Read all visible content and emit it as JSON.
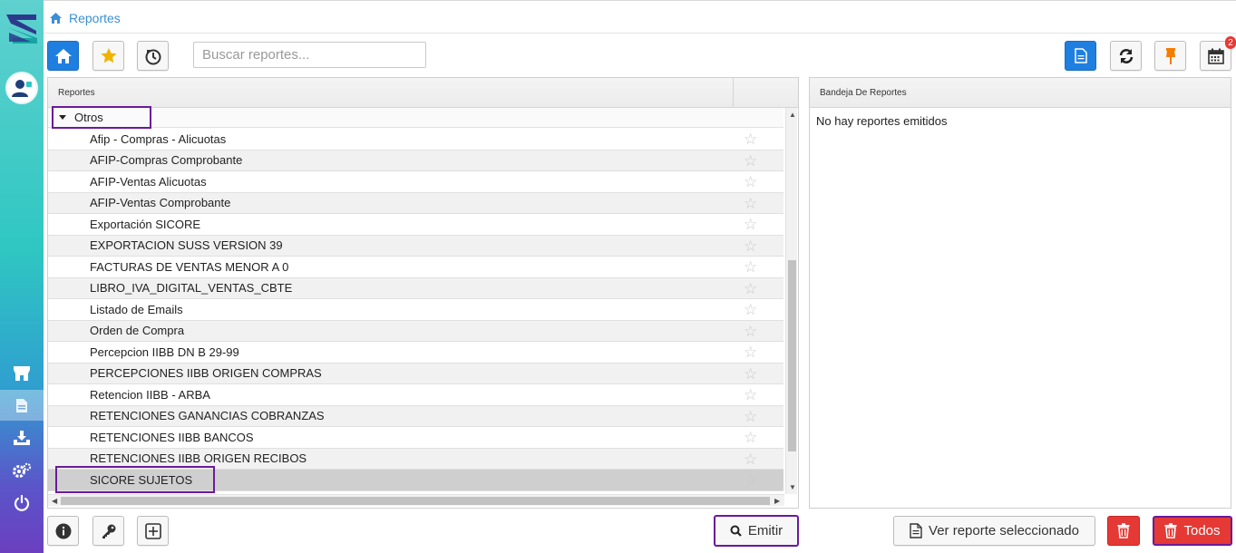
{
  "breadcrumb": {
    "label": "Reportes"
  },
  "toolbar": {
    "search_placeholder": "Buscar reportes...",
    "badge_count": "2"
  },
  "reports_panel": {
    "header": "Reportes",
    "group": "Otros",
    "items": [
      "Afip - Compras - Alicuotas",
      "AFIP-Compras Comprobante",
      "AFIP-Ventas Alicuotas",
      "AFIP-Ventas Comprobante",
      "Exportación SICORE",
      "EXPORTACION SUSS VERSION 39",
      "FACTURAS DE VENTAS MENOR A 0",
      "LIBRO_IVA_DIGITAL_VENTAS_CBTE",
      "Listado de Emails",
      "Orden de Compra",
      "Percepcion IIBB DN B 29-99",
      "PERCEPCIONES IIBB ORIGEN COMPRAS",
      "Retencion IIBB - ARBA",
      "RETENCIONES GANANCIAS COBRANZAS",
      "RETENCIONES IIBB BANCOS",
      "RETENCIONES IIBB ORIGEN RECIBOS",
      "SICORE SUJETOS"
    ],
    "selected_item": "SICORE SUJETOS"
  },
  "tray_panel": {
    "header": "Bandeja De Reportes",
    "empty_text": "No hay reportes emitidos"
  },
  "actions": {
    "emit_label": "Emitir",
    "view_selected_label": "Ver reporte seleccionado",
    "delete_all_label": "Todos"
  },
  "colors": {
    "accent_blue": "#1f7fe0",
    "danger_red": "#e53935",
    "highlight_purple": "#6a1b9a"
  }
}
